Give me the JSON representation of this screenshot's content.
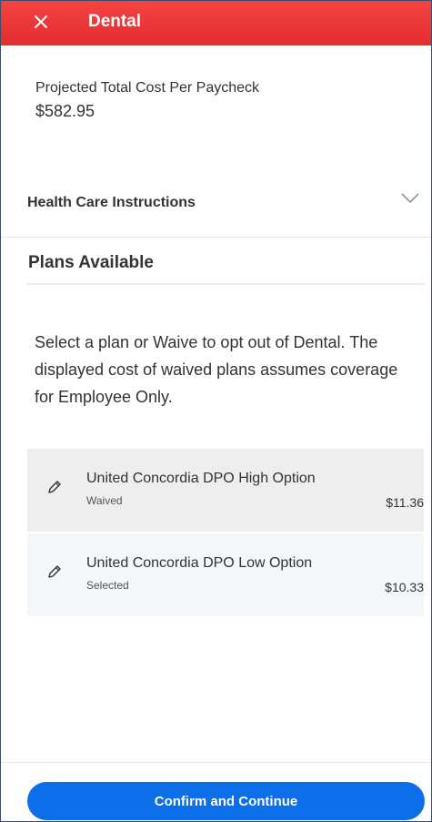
{
  "header": {
    "title": "Dental",
    "close_icon": "close-icon",
    "background_color": "#e32d30"
  },
  "projected_cost": {
    "label": "Projected Total Cost Per Paycheck",
    "value": "$582.95"
  },
  "instructions": {
    "label": "Health Care Instructions",
    "icon": "chevron-down-icon"
  },
  "plans": {
    "heading": "Plans Available",
    "description": "Select a plan or Waive to opt out of Dental. The displayed cost of waived plans assumes coverage for Employee Only.",
    "items": [
      {
        "name": "United Concordia DPO High Option",
        "status": "Waived",
        "price": "$11.36",
        "icon": "pencil-icon"
      },
      {
        "name": "United Concordia DPO Low Option",
        "status": "Selected",
        "price": "$10.33",
        "icon": "pencil-icon"
      }
    ]
  },
  "footer": {
    "confirm_label": "Confirm and Continue",
    "button_color": "#0c6ee8"
  }
}
